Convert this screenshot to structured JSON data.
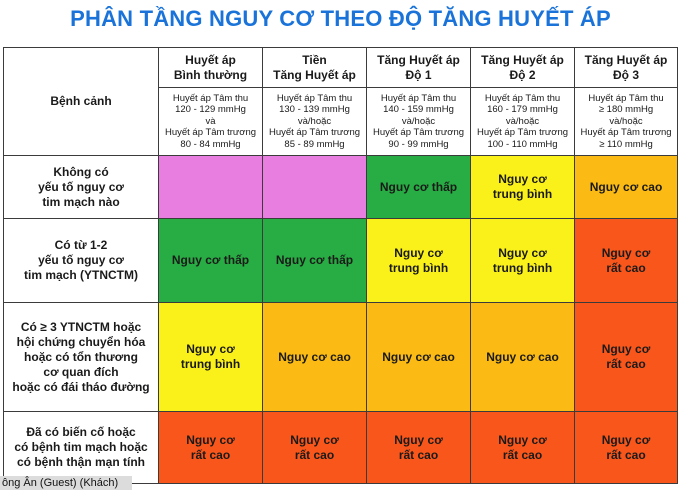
{
  "title": "PHÂN TẦNG NGUY CƠ THEO ĐỘ TĂNG HUYẾT ÁP",
  "header": {
    "row_label": "Bệnh cảnh",
    "columns": [
      {
        "name": "Huyết áp\nBình thường",
        "criteria": "Huyết áp Tâm thu\n120 - 129 mmHg\nvà\nHuyết áp Tâm trương\n80 - 84 mmHg"
      },
      {
        "name": "Tiền\nTăng Huyết áp",
        "criteria": "Huyết áp Tâm thu\n130 - 139 mmHg\nvà/hoặc\nHuyết áp Tâm trương\n85 - 89 mmHg"
      },
      {
        "name": "Tăng Huyết áp\nĐộ 1",
        "criteria": "Huyết áp Tâm thu\n140 - 159 mmHg\nvà/hoặc\nHuyết áp Tâm trương\n90 - 99 mmHg"
      },
      {
        "name": "Tăng Huyết áp\nĐộ 2",
        "criteria": "Huyết áp Tâm thu\n160 - 179 mmHg\nvà/hoặc\nHuyết áp Tâm trương\n100 - 110 mmHg"
      },
      {
        "name": "Tăng Huyết áp\nĐộ 3",
        "criteria": "Huyết áp Tâm thu\n≥ 180 mmHg\nvà/hoặc\nHuyết áp Tâm trương\n≥ 110 mmHg"
      }
    ]
  },
  "rows": [
    {
      "label": "Không có\nyếu tố nguy cơ\ntim mạch nào",
      "cells": [
        "",
        "",
        "Nguy cơ thấp",
        "Nguy cơ\ntrung bình",
        "Nguy cơ cao"
      ]
    },
    {
      "label": "Có từ 1-2\nyếu tố nguy cơ\ntim mạch (YTNCTM)",
      "cells": [
        "Nguy cơ thấp",
        "Nguy cơ thấp",
        "Nguy cơ\ntrung bình",
        "Nguy cơ\ntrung bình",
        "Nguy cơ\nrất cao"
      ]
    },
    {
      "label": "Có ≥ 3 YTNCTM hoặc\nhội chứng chuyển hóa\nhoặc có tổn thương\ncơ quan đích\nhoặc có đái tháo đường",
      "cells": [
        "Nguy cơ\ntrung bình",
        "Nguy cơ cao",
        "Nguy cơ cao",
        "Nguy cơ cao",
        "Nguy cơ\nrất cao"
      ]
    },
    {
      "label": "Đã có biến cố hoặc\ncó bệnh tim mạch hoặc\ncó bệnh thận mạn tính",
      "cells": [
        "Nguy cơ\nrất cao",
        "Nguy cơ\nrất cao",
        "Nguy cơ\nrất cao",
        "Nguy cơ\nrất cao",
        "Nguy cơ\nrất cao"
      ]
    }
  ],
  "colors": {
    "title": "#1a73d9",
    "pink": "#e77ee0",
    "green": "#27ad43",
    "yellow": "#fbf11a",
    "orange": "#fbbb14",
    "red": "#f9561b"
  },
  "footer": {
    "guest_label": "ông Ân (Guest) (Khách)"
  }
}
